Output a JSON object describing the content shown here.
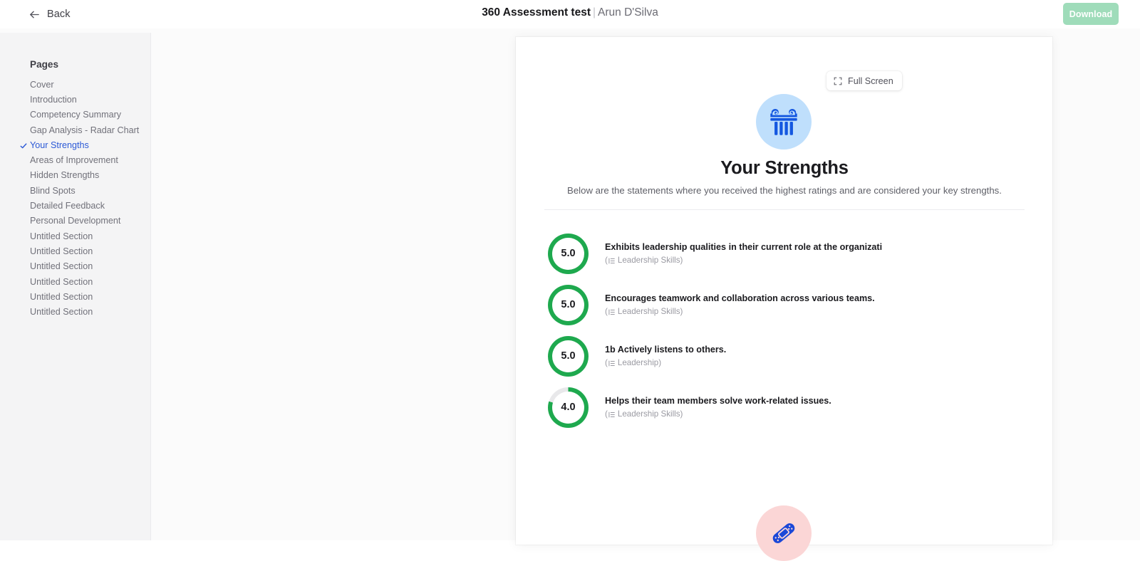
{
  "topbar": {
    "back_label": "Back",
    "back_icon": "arrow-left-icon",
    "title_main": "360 Assessment test",
    "title_separator": "|",
    "title_sub": "Arun D'Silva",
    "download_label": "Download",
    "download_color": "#9fdcba"
  },
  "sidebar": {
    "title": "Pages",
    "active_index": 4,
    "active_color": "#2b59d6",
    "check_icon": "check-icon",
    "items": [
      {
        "label": "Cover"
      },
      {
        "label": "Introduction"
      },
      {
        "label": "Competency Summary"
      },
      {
        "label": "Gap Analysis - Radar Chart"
      },
      {
        "label": "Your Strengths"
      },
      {
        "label": "Areas of Improvement"
      },
      {
        "label": "Hidden Strengths"
      },
      {
        "label": "Blind Spots"
      },
      {
        "label": "Detailed Feedback"
      },
      {
        "label": "Personal Development"
      },
      {
        "label": "Untitled Section"
      },
      {
        "label": "Untitled Section"
      },
      {
        "label": "Untitled Section"
      },
      {
        "label": "Untitled Section"
      },
      {
        "label": "Untitled Section"
      },
      {
        "label": "Untitled Section"
      }
    ]
  },
  "viewer": {
    "fullscreen_label": "Full Screen",
    "fullscreen_icon": "expand-icon"
  },
  "report": {
    "hero_icon": "pillar-column-icon",
    "hero_icon_bg": "#bfdffc",
    "hero_icon_color": "#1457e0",
    "heading": "Your Strengths",
    "subtitle": "Below are the statements where you received the highest ratings and are considered your key strengths.",
    "ring_color": "#1ea94e",
    "ring_track_color": "#e8e8ea",
    "max_score": 5,
    "strengths": [
      {
        "score": "5.0",
        "score_value": 5.0,
        "statement": "Exhibits leadership qualities in their current role at the organizati",
        "category": "Leadership Skills",
        "category_icon": "list-icon"
      },
      {
        "score": "5.0",
        "score_value": 5.0,
        "statement": "Encourages teamwork and collaboration across various teams.",
        "category": "Leadership Skills",
        "category_icon": "list-icon"
      },
      {
        "score": "5.0",
        "score_value": 5.0,
        "statement": "1b Actively listens to others.",
        "category": "Leadership",
        "category_icon": "list-icon"
      },
      {
        "score": "4.0",
        "score_value": 4.0,
        "statement": "Helps their team members solve work-related issues.",
        "category": "Leadership Skills",
        "category_icon": "list-icon"
      }
    ],
    "footer_icon": "bandage-icon",
    "footer_icon_bg": "#fbd6d6",
    "footer_icon_color": "#1b48d8"
  }
}
